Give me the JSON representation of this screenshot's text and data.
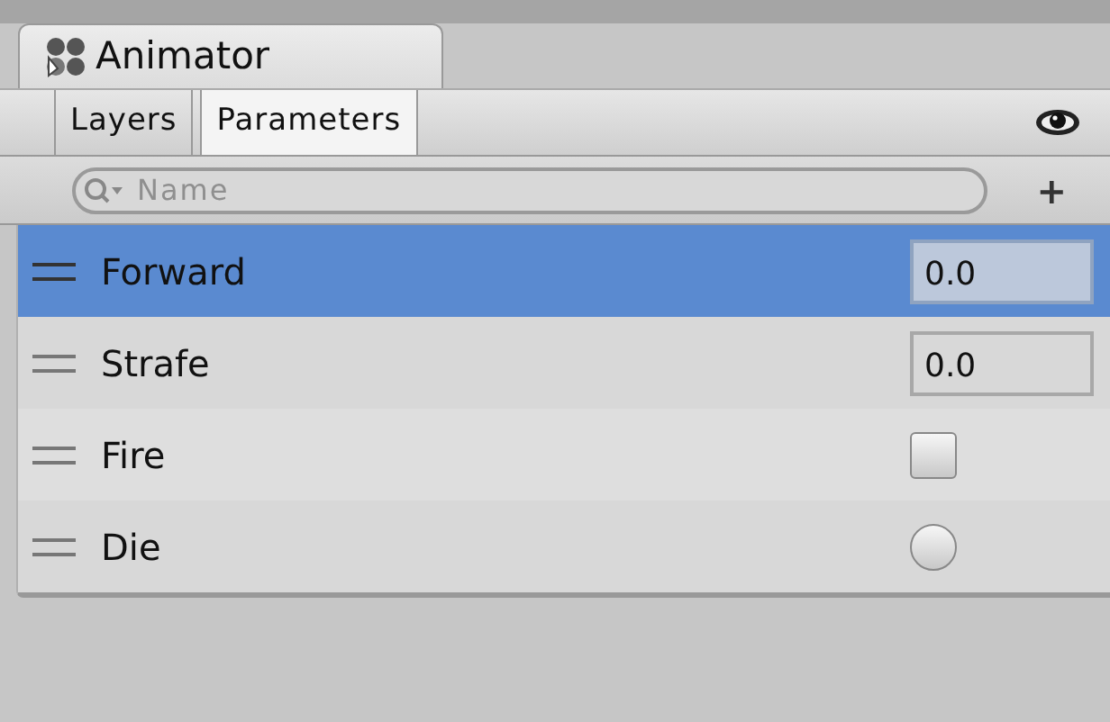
{
  "window": {
    "title": "Animator"
  },
  "tabs": [
    {
      "label": "Layers",
      "selected": false
    },
    {
      "label": "Parameters",
      "selected": true
    }
  ],
  "search": {
    "placeholder": "Name"
  },
  "add_button": "+",
  "parameters": [
    {
      "name": "Forward",
      "kind": "float",
      "value": "0.0",
      "selected": true
    },
    {
      "name": "Strafe",
      "kind": "float",
      "value": "0.0",
      "selected": false
    },
    {
      "name": "Fire",
      "kind": "bool",
      "checked": false,
      "selected": false
    },
    {
      "name": "Die",
      "kind": "trigger",
      "on": false,
      "selected": false
    }
  ]
}
